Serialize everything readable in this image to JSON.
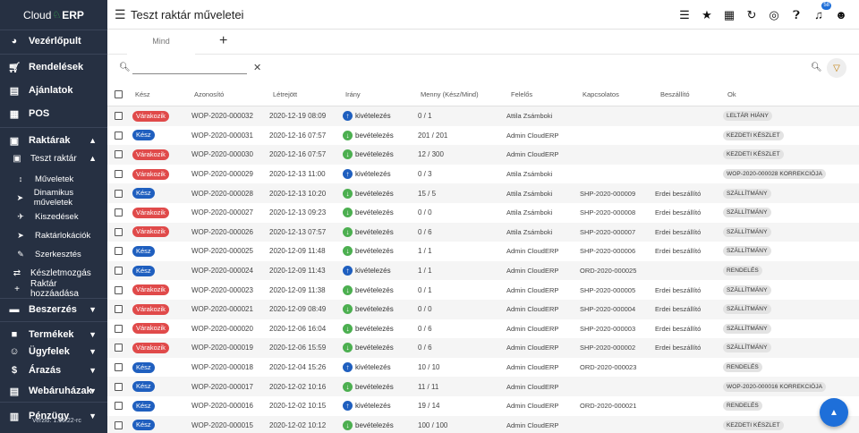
{
  "app": {
    "logo_left": "Cloud",
    "logo_right": "ERP",
    "version": "Verzió: 1.16.22-rc"
  },
  "topbar": {
    "title": "Teszt raktár műveletei",
    "notification_count": "58"
  },
  "sidebar": {
    "vezerlopult": "Vezérlőpult",
    "rendelesek": "Rendelések",
    "ajanlatok": "Ajánlatok",
    "pos": "POS",
    "raktarak": "Raktárak",
    "teszt_raktar": "Teszt raktár",
    "muveletek": "Műveletek",
    "dinamikus": "Dinamikus műveletek",
    "kiszedesek": "Kiszedések",
    "raktarlokaciok": "Raktárlokációk",
    "szerkesztes": "Szerkesztés",
    "keszletmozgas": "Készletmozgás",
    "raktar_hozzaadasa": "Raktár hozzáadása",
    "beszerzes": "Beszerzés",
    "termekek": "Termékek",
    "ugyfelek": "Ügyfelek",
    "arazas": "Árazás",
    "webaruhazak": "Webáruházak",
    "penzugy": "Pénzügy"
  },
  "tabs": {
    "mind": "Mind"
  },
  "search": {
    "placeholder": ""
  },
  "table": {
    "headers": {
      "kesz": "Kész",
      "azonosito": "Azonosító",
      "letrejott": "Létrejött",
      "irany": "Irány",
      "menny": "Menny (Kész/Mind)",
      "felelos": "Felelős",
      "kapcsolatos": "Kapcsolatos",
      "beszallito": "Beszállító",
      "ok": "Ok"
    },
    "rows": [
      {
        "status": "Várakozik",
        "id": "WOP-2020-000032",
        "created": "2020-12-19 08:09",
        "dir": "kivételezés",
        "qty": "0 / 1",
        "resp": "Attila Zsámboki",
        "rel": "",
        "supp": "",
        "ok": "LELTÁR HIÁNY"
      },
      {
        "status": "Kész",
        "id": "WOP-2020-000031",
        "created": "2020-12-16 07:57",
        "dir": "bevételezés",
        "qty": "201 / 201",
        "resp": "Admin CloudERP",
        "rel": "",
        "supp": "",
        "ok": "KEZDETI KÉSZLET"
      },
      {
        "status": "Várakozik",
        "id": "WOP-2020-000030",
        "created": "2020-12-16 07:57",
        "dir": "bevételezés",
        "qty": "12 / 300",
        "resp": "Admin CloudERP",
        "rel": "",
        "supp": "",
        "ok": "KEZDETI KÉSZLET"
      },
      {
        "status": "Várakozik",
        "id": "WOP-2020-000029",
        "created": "2020-12-13 11:00",
        "dir": "kivételezés",
        "qty": "0 / 3",
        "resp": "Attila Zsámboki",
        "rel": "",
        "supp": "",
        "ok": "WOP-2020-000028 KORREKCIÓJA"
      },
      {
        "status": "Kész",
        "id": "WOP-2020-000028",
        "created": "2020-12-13 10:20",
        "dir": "bevételezés",
        "qty": "15 / 5",
        "resp": "Attila Zsámboki",
        "rel": "SHP-2020-000009",
        "supp": "Erdei beszállító",
        "ok": "SZÁLLÍTMÁNY"
      },
      {
        "status": "Várakozik",
        "id": "WOP-2020-000027",
        "created": "2020-12-13 09:23",
        "dir": "bevételezés",
        "qty": "0 / 0",
        "resp": "Attila Zsámboki",
        "rel": "SHP-2020-000008",
        "supp": "Erdei beszállító",
        "ok": "SZÁLLÍTMÁNY"
      },
      {
        "status": "Várakozik",
        "id": "WOP-2020-000026",
        "created": "2020-12-13 07:57",
        "dir": "bevételezés",
        "qty": "0 / 6",
        "resp": "Attila Zsámboki",
        "rel": "SHP-2020-000007",
        "supp": "Erdei beszállító",
        "ok": "SZÁLLÍTMÁNY"
      },
      {
        "status": "Kész",
        "id": "WOP-2020-000025",
        "created": "2020-12-09 11:48",
        "dir": "bevételezés",
        "qty": "1 / 1",
        "resp": "Admin CloudERP",
        "rel": "SHP-2020-000006",
        "supp": "Erdei beszállító",
        "ok": "SZÁLLÍTMÁNY"
      },
      {
        "status": "Kész",
        "id": "WOP-2020-000024",
        "created": "2020-12-09 11:43",
        "dir": "kivételezés",
        "qty": "1 / 1",
        "resp": "Admin CloudERP",
        "rel": "ORD-2020-000025",
        "supp": "",
        "ok": "RENDELÉS"
      },
      {
        "status": "Várakozik",
        "id": "WOP-2020-000023",
        "created": "2020-12-09 11:38",
        "dir": "bevételezés",
        "qty": "0 / 1",
        "resp": "Admin CloudERP",
        "rel": "SHP-2020-000005",
        "supp": "Erdei beszállító",
        "ok": "SZÁLLÍTMÁNY"
      },
      {
        "status": "Várakozik",
        "id": "WOP-2020-000021",
        "created": "2020-12-09 08:49",
        "dir": "bevételezés",
        "qty": "0 / 0",
        "resp": "Admin CloudERP",
        "rel": "SHP-2020-000004",
        "supp": "Erdei beszállító",
        "ok": "SZÁLLÍTMÁNY"
      },
      {
        "status": "Várakozik",
        "id": "WOP-2020-000020",
        "created": "2020-12-06 16:04",
        "dir": "bevételezés",
        "qty": "0 / 6",
        "resp": "Admin CloudERP",
        "rel": "SHP-2020-000003",
        "supp": "Erdei beszállító",
        "ok": "SZÁLLÍTMÁNY"
      },
      {
        "status": "Várakozik",
        "id": "WOP-2020-000019",
        "created": "2020-12-06 15:59",
        "dir": "bevételezés",
        "qty": "0 / 6",
        "resp": "Admin CloudERP",
        "rel": "SHP-2020-000002",
        "supp": "Erdei beszállító",
        "ok": "SZÁLLÍTMÁNY"
      },
      {
        "status": "Kész",
        "id": "WOP-2020-000018",
        "created": "2020-12-04 15:26",
        "dir": "kivételezés",
        "qty": "10 / 10",
        "resp": "Admin CloudERP",
        "rel": "ORD-2020-000023",
        "supp": "",
        "ok": "RENDELÉS"
      },
      {
        "status": "Kész",
        "id": "WOP-2020-000017",
        "created": "2020-12-02 10:16",
        "dir": "bevételezés",
        "qty": "11 / 11",
        "resp": "Admin CloudERP",
        "rel": "",
        "supp": "",
        "ok": "WOP-2020-000016 KORREKCIÓJA"
      },
      {
        "status": "Kész",
        "id": "WOP-2020-000016",
        "created": "2020-12-02 10:15",
        "dir": "kivételezés",
        "qty": "19 / 14",
        "resp": "Admin CloudERP",
        "rel": "ORD-2020-000021",
        "supp": "",
        "ok": "RENDELÉS"
      },
      {
        "status": "Kész",
        "id": "WOP-2020-000015",
        "created": "2020-12-02 10:12",
        "dir": "bevételezés",
        "qty": "100 / 100",
        "resp": "Admin CloudERP",
        "rel": "",
        "supp": "",
        "ok": "KEZDETI KÉSZLET"
      }
    ]
  },
  "colors": {
    "sidebar": "#263042",
    "waiting": "#e04a4a",
    "done": "#1f5fbf",
    "in": "#4caf50",
    "out": "#1f5fbf"
  }
}
